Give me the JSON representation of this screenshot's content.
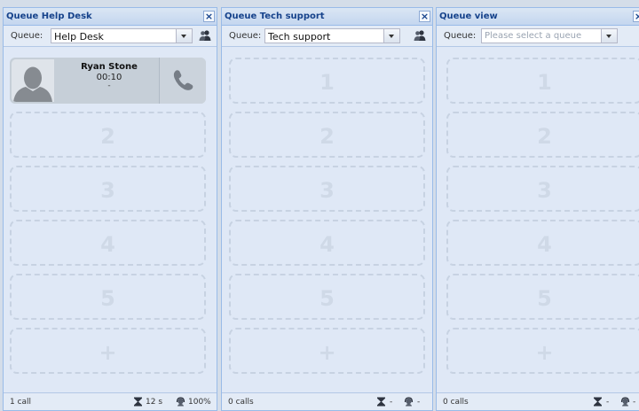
{
  "panels": [
    {
      "title": "Queue Help Desk",
      "queue_label": "Queue:",
      "queue_value": "Help Desk",
      "calls": "1 call",
      "wait": "12 s",
      "service": "100%",
      "call": {
        "name": "Ryan Stone",
        "duration": "00:10",
        "extra": "-"
      },
      "slots": [
        "2",
        "3",
        "4",
        "5",
        "+"
      ]
    },
    {
      "title": "Queue Tech support",
      "queue_label": "Queue:",
      "queue_value": "Tech support",
      "calls": "0 calls",
      "wait": "-",
      "service": "-",
      "slots": [
        "1",
        "2",
        "3",
        "4",
        "5",
        "+"
      ]
    },
    {
      "title": "Queue view",
      "queue_label": "Queue:",
      "queue_placeholder": "Please select a queue",
      "calls": "0 calls",
      "wait": "-",
      "service": "-",
      "slots": [
        "1",
        "2",
        "3",
        "4",
        "5",
        "+"
      ]
    }
  ],
  "colors": {
    "panel_bg": "#dfe8f6",
    "header_text": "#15428b",
    "border": "#99bbe8",
    "slot_dash": "#c7d2e2",
    "call_card": "#c6cfd8"
  },
  "icons": [
    "close-icon",
    "agents-icon",
    "phone-icon",
    "hourglass-icon",
    "headset-icon",
    "person-silhouette"
  ]
}
